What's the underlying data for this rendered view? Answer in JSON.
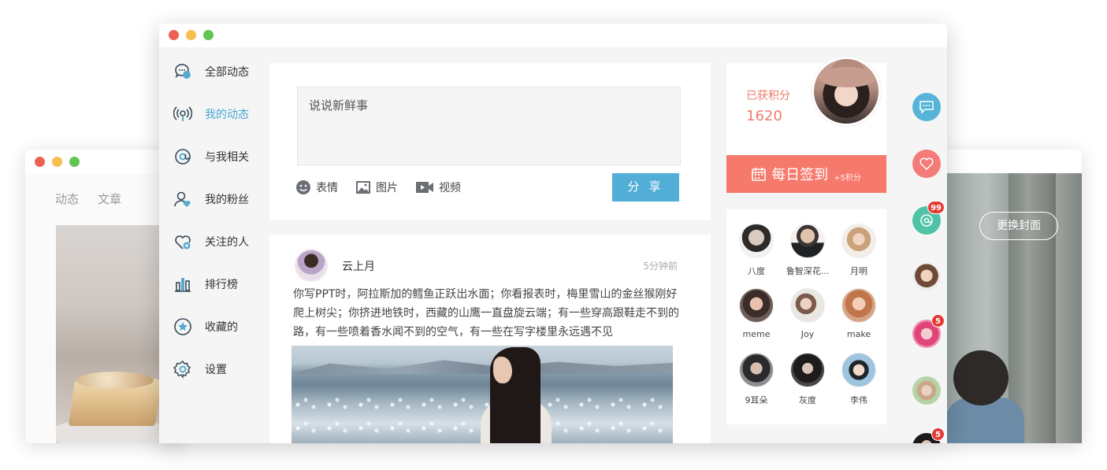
{
  "back_left": {
    "tabs": [
      "动态",
      "文章"
    ]
  },
  "back_right": {
    "cover_button": "更换封面"
  },
  "sidebar": {
    "items": [
      {
        "label": "全部动态",
        "icon": "chat-bubbles-icon",
        "active": false
      },
      {
        "label": "我的动态",
        "icon": "broadcast-icon",
        "active": true
      },
      {
        "label": "与我相关",
        "icon": "at-sign-icon",
        "active": false
      },
      {
        "label": "我的粉丝",
        "icon": "user-heart-icon",
        "active": false
      },
      {
        "label": "关注的人",
        "icon": "heart-plus-icon",
        "active": false
      },
      {
        "label": "排行榜",
        "icon": "bar-chart-icon",
        "active": false
      },
      {
        "label": "收藏的",
        "icon": "star-circle-icon",
        "active": false
      },
      {
        "label": "设置",
        "icon": "gear-icon",
        "active": false
      }
    ]
  },
  "composer": {
    "placeholder": "说说新鲜事",
    "tools": [
      {
        "label": "表情",
        "icon": "smiley-icon"
      },
      {
        "label": "图片",
        "icon": "image-icon"
      },
      {
        "label": "视频",
        "icon": "video-icon"
      }
    ],
    "share_label": "分 享"
  },
  "feed": {
    "author": "云上月",
    "time": "5分钟前",
    "text": "你写PPT时，阿拉斯加的鳕鱼正跃出水面；你看报表时，梅里雪山的金丝猴刚好爬上树尖；你挤进地铁时，西藏的山鹰一直盘旋云端；有一些穿高跟鞋走不到的路，有一些喷着香水闻不到的空气，有一些在写字楼里永远遇不见"
  },
  "points": {
    "label": "已获积分",
    "value": "1620",
    "checkin_label": "每日签到",
    "checkin_bonus": "+5积分"
  },
  "friends": [
    {
      "name": "八度"
    },
    {
      "name": "鲁智深花..."
    },
    {
      "name": "月明"
    },
    {
      "name": "meme"
    },
    {
      "name": "Joy"
    },
    {
      "name": "make"
    },
    {
      "name": "9耳朵"
    },
    {
      "name": "灰度"
    },
    {
      "name": "李伟"
    }
  ],
  "rail": {
    "items": [
      {
        "icon": "message-icon",
        "badge": ""
      },
      {
        "icon": "heart-icon",
        "badge": ""
      },
      {
        "icon": "at-icon",
        "badge": "99"
      },
      {
        "icon": "avatar",
        "badge": ""
      },
      {
        "icon": "avatar",
        "badge": "5"
      },
      {
        "icon": "avatar",
        "badge": ""
      },
      {
        "icon": "avatar",
        "badge": "5"
      }
    ]
  },
  "colors": {
    "accent_blue": "#52aed7",
    "accent_coral": "#f57a6c",
    "badge_red": "#e53b35",
    "rail_teal": "#4fc3a6"
  }
}
